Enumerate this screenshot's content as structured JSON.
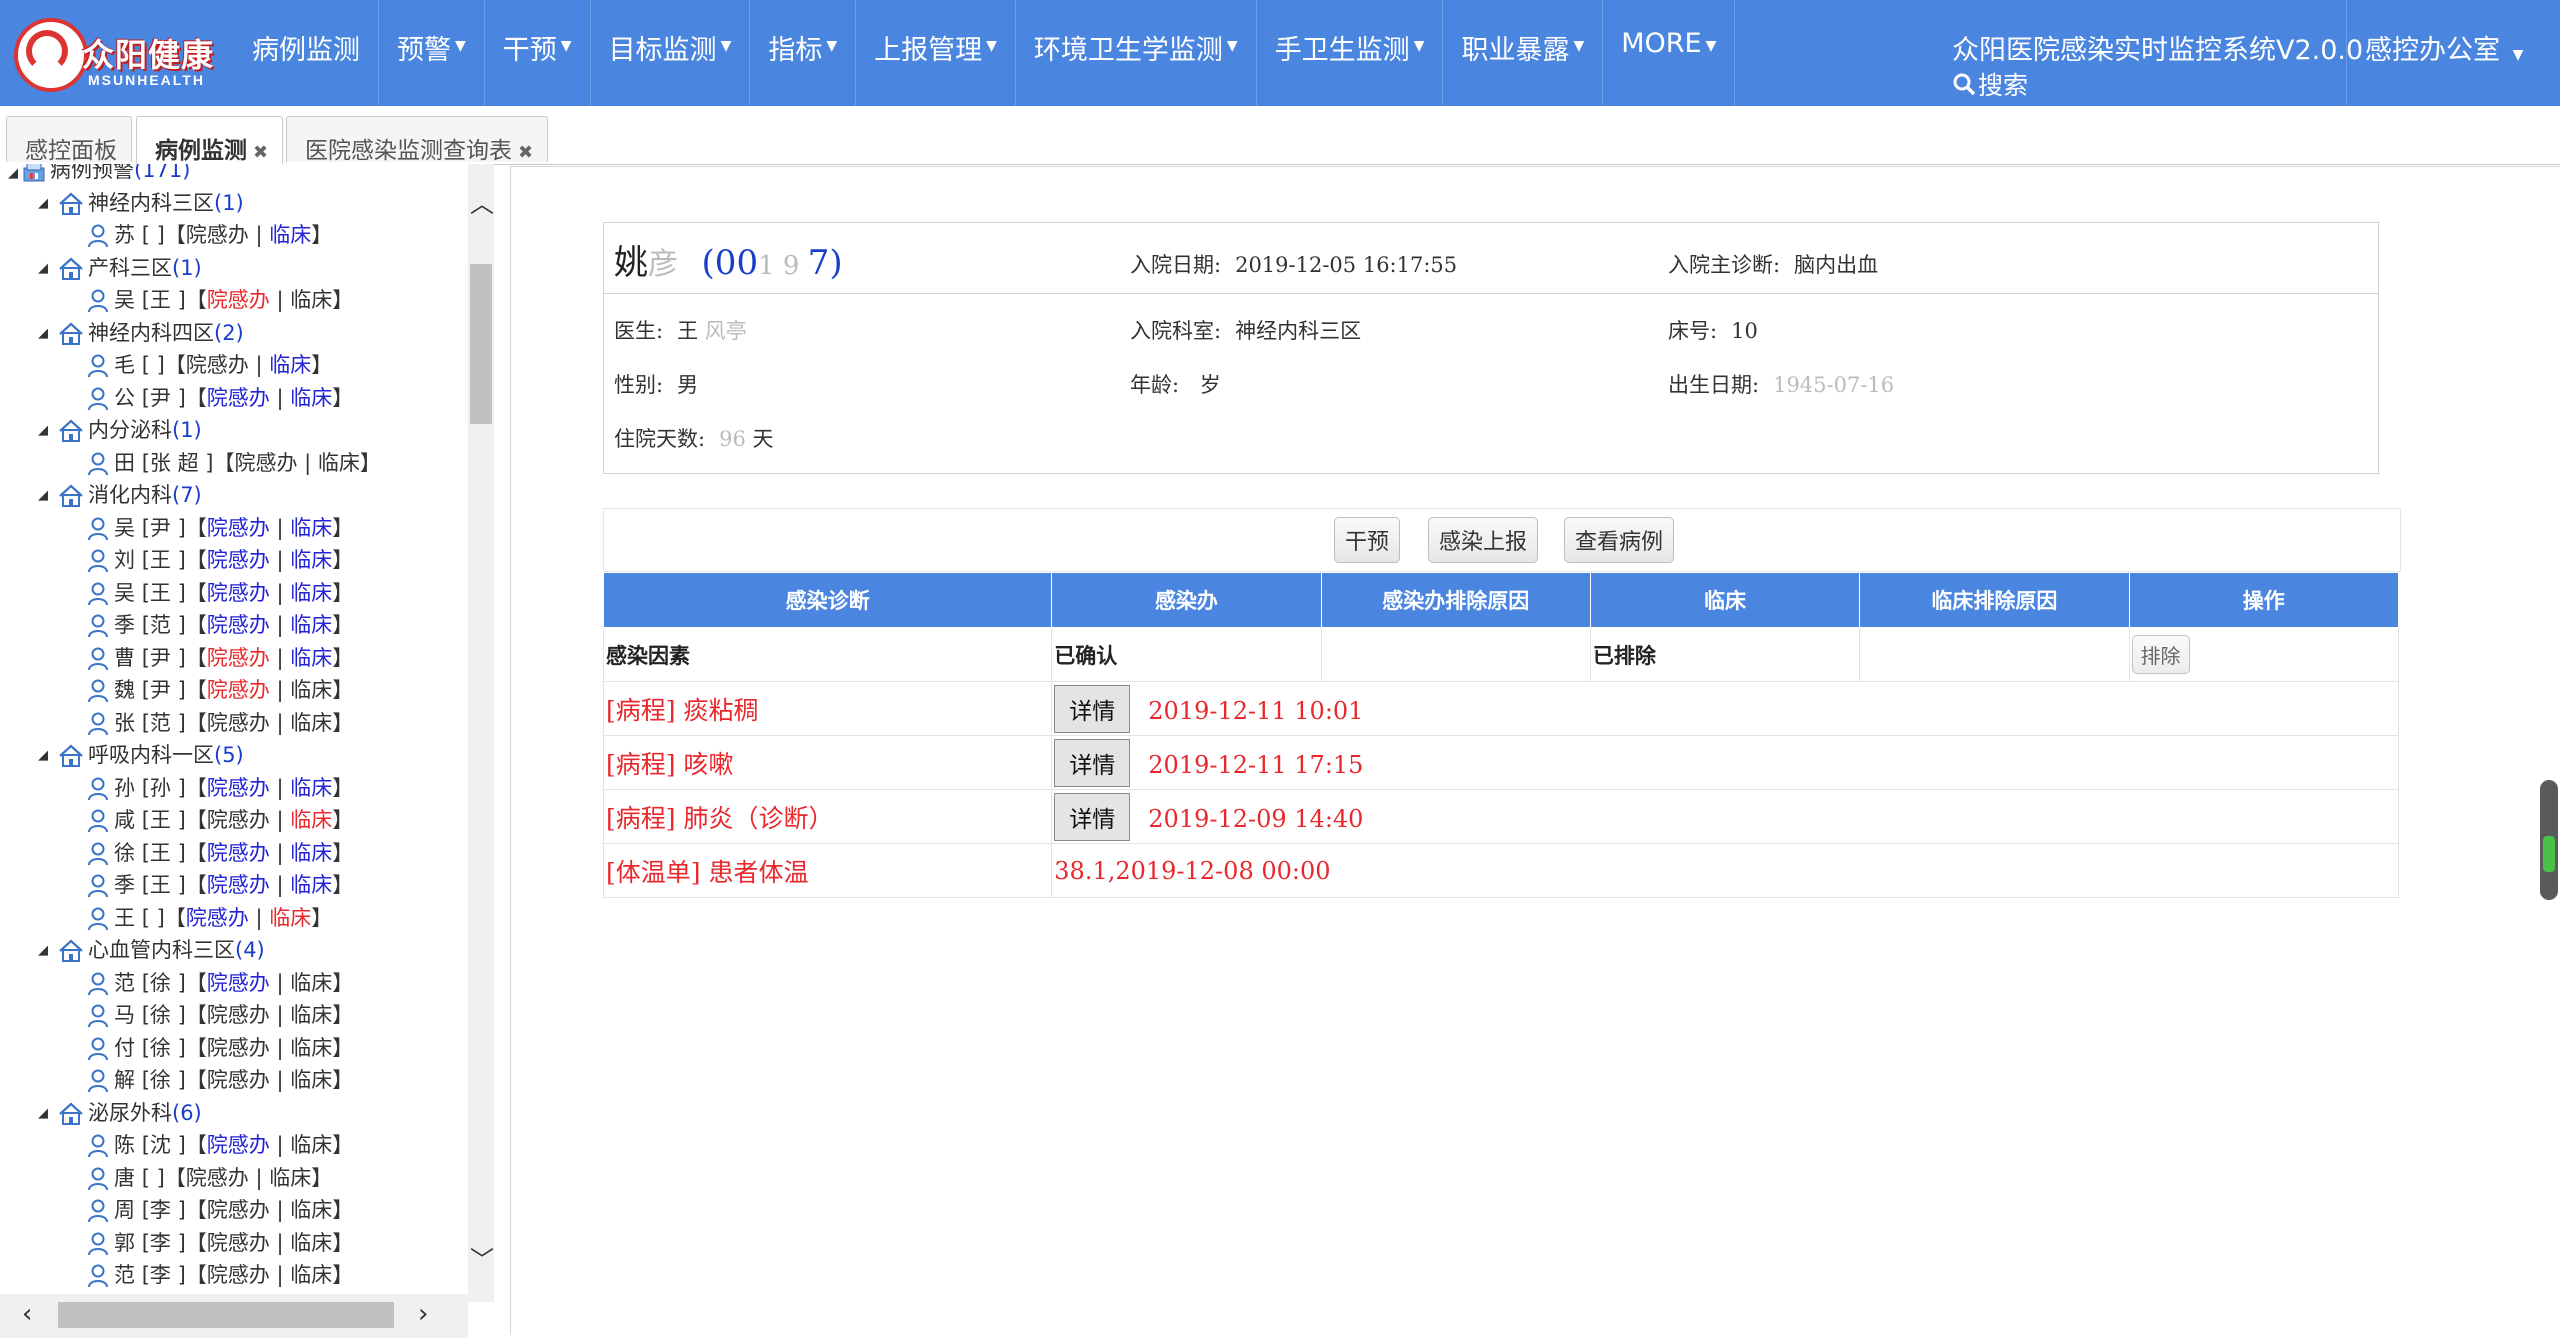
{
  "app": {
    "brand_cn": "众阳健康",
    "brand_en": "MSUNHEALTH",
    "system_title": "众阳医院感染实时监控系统V2.0.0",
    "search_label": "搜索",
    "user_dept": "感控办公室",
    "colors": {
      "nav": "#4a86e0",
      "accent_red": "#e8282c",
      "link_blue": "#2323d6"
    }
  },
  "menu": [
    {
      "label": "病例监测",
      "dropdown": false
    },
    {
      "label": "预警",
      "dropdown": true
    },
    {
      "label": "干预",
      "dropdown": true
    },
    {
      "label": "目标监测",
      "dropdown": true
    },
    {
      "label": "指标",
      "dropdown": true
    },
    {
      "label": "上报管理",
      "dropdown": true
    },
    {
      "label": "环境卫生学监测",
      "dropdown": true
    },
    {
      "label": "手卫生监测",
      "dropdown": true
    },
    {
      "label": "职业暴露",
      "dropdown": true
    },
    {
      "label": "MORE",
      "dropdown": true
    }
  ],
  "tabs": [
    {
      "label": "感控面板",
      "closable": false,
      "active": false
    },
    {
      "label": "病例监测",
      "closable": true,
      "active": true
    },
    {
      "label": "医院感染监测查询表",
      "closable": true,
      "active": false
    }
  ],
  "tree": {
    "root": {
      "label": "病例预警",
      "count": "(171)"
    },
    "departments": [
      {
        "name": "神经内科三区",
        "count": "(1)",
        "patients": [
          {
            "name": "苏",
            "doctor": "",
            "flags": [
              "black",
              "blue"
            ]
          }
        ]
      },
      {
        "name": "产科三区",
        "count": "(1)",
        "patients": [
          {
            "name": "吴",
            "doctor": "王",
            "flags": [
              "red",
              "black"
            ]
          }
        ]
      },
      {
        "name": "神经内科四区",
        "count": "(2)",
        "patients": [
          {
            "name": "毛",
            "doctor": "",
            "flags": [
              "black",
              "blue"
            ]
          },
          {
            "name": "公",
            "doctor": "尹",
            "flags": [
              "blue",
              "blue"
            ]
          }
        ]
      },
      {
        "name": "内分泌科",
        "count": "(1)",
        "patients": [
          {
            "name": "田",
            "doctor": "张 超",
            "flags": [
              "black",
              "black"
            ]
          }
        ]
      },
      {
        "name": "消化内科",
        "count": "(7)",
        "patients": [
          {
            "name": "吴",
            "doctor": "尹",
            "flags": [
              "blue",
              "blue"
            ]
          },
          {
            "name": "刘",
            "doctor": "王",
            "flags": [
              "blue",
              "blue"
            ]
          },
          {
            "name": "吴",
            "doctor": "王",
            "flags": [
              "blue",
              "blue"
            ]
          },
          {
            "name": "季",
            "doctor": "范",
            "flags": [
              "blue",
              "blue"
            ]
          },
          {
            "name": "曹",
            "doctor": "尹",
            "flags": [
              "red",
              "blue"
            ]
          },
          {
            "name": "魏",
            "doctor": "尹",
            "flags": [
              "red",
              "black"
            ]
          },
          {
            "name": "张",
            "doctor": "范",
            "flags": [
              "black",
              "black"
            ]
          }
        ]
      },
      {
        "name": "呼吸内科一区",
        "count": "(5)",
        "patients": [
          {
            "name": "孙",
            "doctor": "孙",
            "flags": [
              "blue",
              "blue"
            ]
          },
          {
            "name": "咸",
            "doctor": "王",
            "flags": [
              "black",
              "red"
            ]
          },
          {
            "name": "徐",
            "doctor": "王",
            "flags": [
              "blue",
              "blue"
            ]
          },
          {
            "name": "季",
            "doctor": "王",
            "flags": [
              "blue",
              "blue"
            ]
          },
          {
            "name": "王",
            "doctor": "",
            "flags": [
              "blue",
              "red"
            ]
          }
        ]
      },
      {
        "name": "心血管内科三区",
        "count": "(4)",
        "patients": [
          {
            "name": "范",
            "doctor": "徐",
            "flags": [
              "blue",
              "black"
            ]
          },
          {
            "name": "马",
            "doctor": "徐",
            "flags": [
              "black",
              "black"
            ]
          },
          {
            "name": "付",
            "doctor": "徐",
            "flags": [
              "black",
              "black"
            ]
          },
          {
            "name": "解",
            "doctor": "徐",
            "flags": [
              "black",
              "black"
            ]
          }
        ]
      },
      {
        "name": "泌尿外科",
        "count": "(6)",
        "patients": [
          {
            "name": "陈",
            "doctor": "沈",
            "flags": [
              "blue",
              "black"
            ]
          },
          {
            "name": "唐",
            "doctor": "",
            "flags": [
              "black",
              "black"
            ]
          },
          {
            "name": "周",
            "doctor": "李",
            "flags": [
              "black",
              "black"
            ]
          },
          {
            "name": "郭",
            "doctor": "李",
            "flags": [
              "black",
              "black"
            ]
          },
          {
            "name": "范",
            "doctor": "李",
            "flags": [
              "black",
              "black"
            ]
          }
        ]
      }
    ],
    "flag_labels": [
      "院感办",
      "临床"
    ]
  },
  "patient": {
    "name": "姚",
    "id": "(00",
    "id_tail": "7)",
    "admit_date_label": "入院日期:",
    "admit_date": "2019-12-05 16:17:55",
    "diagnosis_label": "入院主诊断:",
    "diagnosis": "脑内出血",
    "doctor_label": "医生:",
    "doctor": "王",
    "dept_label": "入院科室:",
    "dept": "神经内科三区",
    "bed_label": "床号:",
    "bed": "10",
    "gender_label": "性别:",
    "gender": "男",
    "age_label": "年龄:",
    "age_unit": "岁",
    "birth_label": "出生日期:",
    "stay_label": "住院天数:",
    "stay_unit": "天"
  },
  "actions": [
    "干预",
    "感染上报",
    "查看病例"
  ],
  "table": {
    "headers": [
      "感染诊断",
      "感染办",
      "感染办排除原因",
      "临床",
      "临床排除原因",
      "操作"
    ],
    "base_row": {
      "diag": "感染因素",
      "office": "已确认",
      "office_reason": "",
      "clinic": "已排除",
      "clinic_reason": "",
      "op": "排除"
    },
    "events": [
      {
        "name": "[病程] 痰粘稠",
        "has_detail": true,
        "time": "2019-12-11 10:01"
      },
      {
        "name": "[病程] 咳嗽",
        "has_detail": true,
        "time": "2019-12-11 17:15"
      },
      {
        "name": "[病程] 肺炎（诊断）",
        "has_detail": true,
        "time": "2019-12-09 14:40"
      },
      {
        "name": "[体温单] 患者体温",
        "has_detail": false,
        "time": "38.1,2019-12-08 00:00"
      }
    ],
    "detail_label": "详情"
  }
}
